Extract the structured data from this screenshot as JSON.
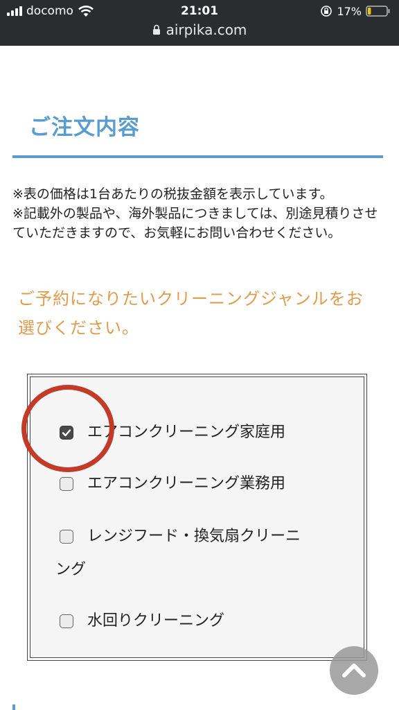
{
  "status_bar": {
    "carrier": "docomo",
    "time": "21:01",
    "battery_percent": "17%",
    "battery_level": 0.17,
    "url": "airpika.com"
  },
  "section": {
    "title": "ご注文内容"
  },
  "notice": {
    "line1": "※表の価格は1台あたりの税抜金額を表示しています。",
    "line2": "※記載外の製品や、海外製品につきましては、別途見積りさせていただきますので、お気軽にお問い合わせください。"
  },
  "prompt": {
    "text": "ご予約になりたいクリーニングジャンルをお選びください。"
  },
  "options": [
    {
      "label": "エアコンクリーニング家庭用",
      "checked": true
    },
    {
      "label": "エアコンクリーニング業務用",
      "checked": false
    },
    {
      "label_part1": "レンジフード・換気扇クリーニ",
      "label_part2": "ング",
      "checked": false
    },
    {
      "label": "水回りクリーニング",
      "checked": false
    }
  ],
  "colors": {
    "accent_blue": "#5b9cce",
    "accent_orange": "#e09b4e",
    "annotation_red": "#c23a28"
  },
  "icons": {
    "scroll_top": "chevron-up-icon",
    "wifi": "wifi-icon",
    "padlock": "padlock-icon"
  }
}
